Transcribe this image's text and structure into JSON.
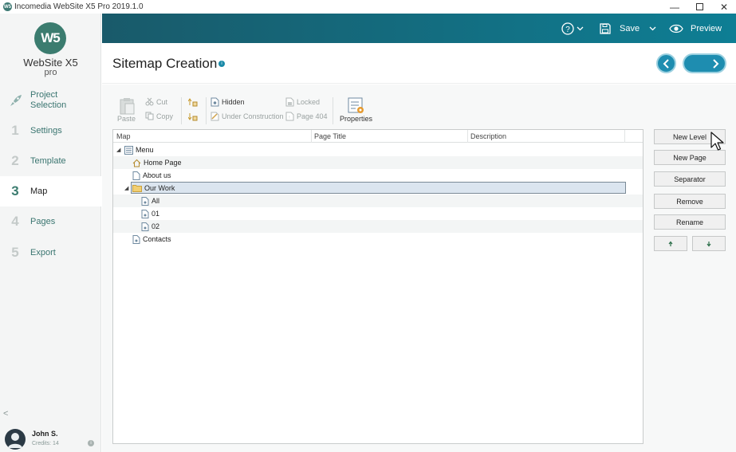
{
  "window": {
    "title": "Incomedia WebSite X5 Pro 2019.1.0",
    "controls": [
      "minimize",
      "maximize",
      "close"
    ]
  },
  "sidebar": {
    "logo_text": "WebSite X5",
    "logo_sub": "pro",
    "logo_mark": "W5",
    "items": [
      {
        "num": "",
        "icon": "rocket-icon",
        "label": "Project Selection",
        "active": false
      },
      {
        "num": "1",
        "label": "Settings",
        "active": false
      },
      {
        "num": "2",
        "label": "Template",
        "active": false
      },
      {
        "num": "3",
        "label": "Map",
        "active": true
      },
      {
        "num": "4",
        "label": "Pages",
        "active": false
      },
      {
        "num": "5",
        "label": "Export",
        "active": false
      }
    ],
    "collapse_glyph": "<",
    "user": {
      "name": "John S.",
      "credits": "Credits: 14"
    }
  },
  "topbar": {
    "help_glyph": "?",
    "save_label": "Save",
    "preview_label": "Preview"
  },
  "header": {
    "title": "Sitemap Creation",
    "info_glyph": "i"
  },
  "toolbar": {
    "paste": "Paste",
    "cut": "Cut",
    "copy": "Copy",
    "hidden": "Hidden",
    "under_construction": "Under Construction",
    "locked": "Locked",
    "page404": "Page 404",
    "properties": "Properties"
  },
  "tree": {
    "columns": [
      "Map",
      "Page Title",
      "Description"
    ],
    "rows": [
      {
        "label": "Menu",
        "level": 0,
        "icon": "menu-icon",
        "expanded": true
      },
      {
        "label": "Home Page",
        "level": 1,
        "icon": "home-icon"
      },
      {
        "label": "About us",
        "level": 1,
        "icon": "page-icon"
      },
      {
        "label": "Our Work",
        "level": 1,
        "icon": "folder-icon",
        "expanded": true,
        "selected": true
      },
      {
        "label": "All",
        "level": 2,
        "icon": "page-icon"
      },
      {
        "label": "01",
        "level": 2,
        "icon": "page-icon"
      },
      {
        "label": "02",
        "level": 2,
        "icon": "page-icon"
      },
      {
        "label": "Contacts",
        "level": 1,
        "icon": "page-icon"
      }
    ]
  },
  "actions": {
    "new_level": "New Level",
    "new_page": "New Page",
    "separator": "Separator",
    "remove": "Remove",
    "rename": "Rename"
  },
  "colors": {
    "accent": "#1e8db0",
    "brand": "#3b7c6f",
    "topbar_start": "#195a6a",
    "topbar_end": "#0e7e94"
  }
}
